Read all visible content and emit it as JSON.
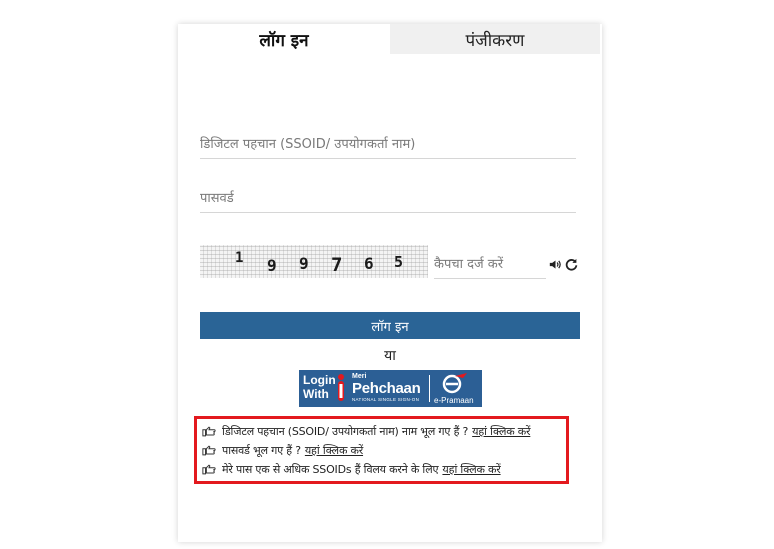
{
  "tabs": {
    "login": "लॉग इन",
    "register": "पंजीकरण"
  },
  "form": {
    "ssoid_placeholder": "डिजिटल पहचान (SSOID/ उपयोगकर्ता नाम)",
    "password_placeholder": "पासवर्ड",
    "captcha_placeholder": "कैपचा दर्ज करें",
    "captcha_digits": [
      "1",
      "9",
      "9",
      "7",
      "6",
      "5"
    ],
    "login_button": "लॉग इन",
    "or_text": "या"
  },
  "pehchaan": {
    "line1": "Login",
    "line2": "With",
    "meri": "Meri",
    "name": "Pehchaan",
    "sub": "NATIONAL SINGLE SIGN-ON",
    "epramaan": "e-Pramaan"
  },
  "help": {
    "forgot_ssoid": "डिजिटल पहचान (SSOID/ उपयोगकर्ता नाम) नाम भूल गए हैं ?",
    "forgot_password": "पासवर्ड भूल गए हैं ?",
    "merge_ssoids": "मेरे पास एक से अधिक SSOIDs हैं विलय करने के लिए",
    "click_here": "यहां क्लिक करें"
  },
  "colors": {
    "button_blue": "#2a6496",
    "pehchaan_blue": "#2c5f95",
    "highlight_red": "#e3191e",
    "tab_inactive": "#f0f0f0"
  },
  "icons": {
    "audio": "speaker-icon",
    "refresh": "refresh-icon",
    "bullet": "hand-pointing-icon"
  }
}
